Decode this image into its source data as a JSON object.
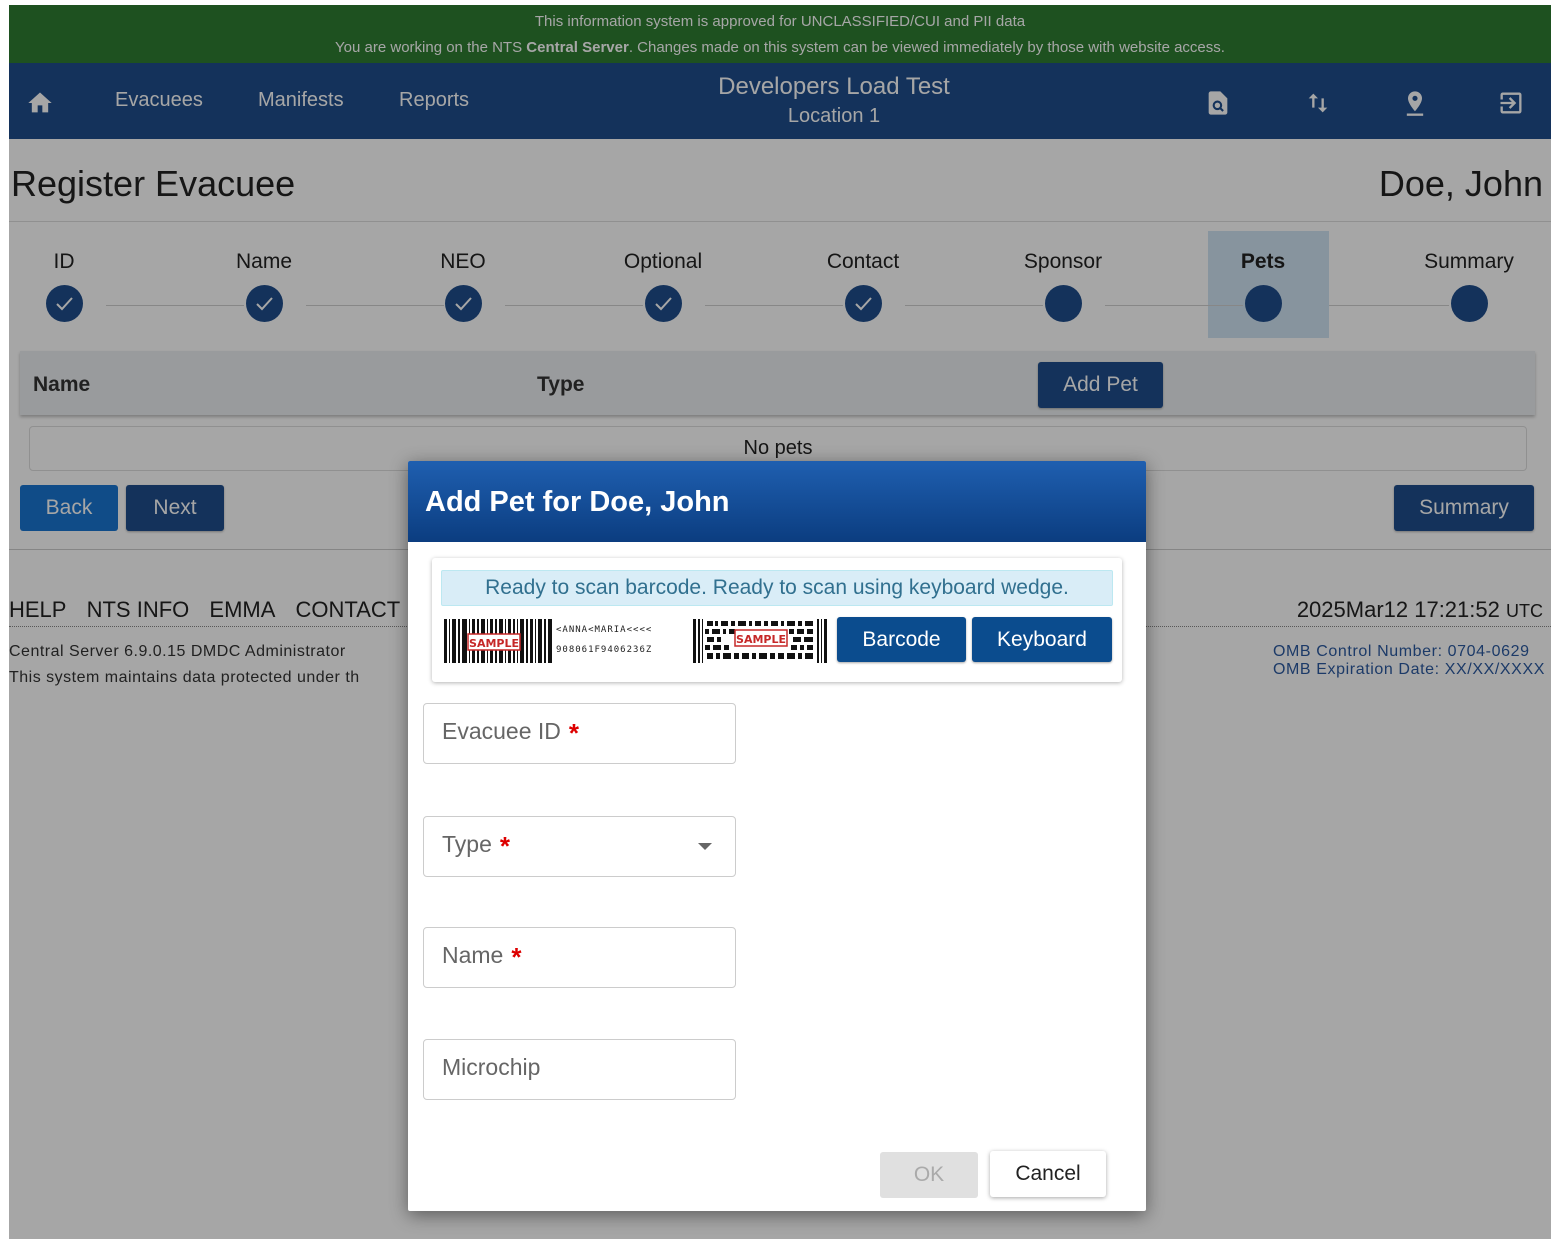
{
  "banner": {
    "line1": "This information system is approved for UNCLASSIFIED/CUI and PII data",
    "line2_pre": "You are working on the NTS ",
    "line2_bold": "Central Server",
    "line2_post": ". Changes made on this system can be viewed immediately by those with website access."
  },
  "nav": {
    "links": [
      "Evacuees",
      "Manifests",
      "Reports"
    ],
    "title": "Developers Load Test",
    "subtitle": "Location 1"
  },
  "page": {
    "title": "Register Evacuee",
    "person": "Doe, John"
  },
  "steps": [
    {
      "label": "ID",
      "done": true
    },
    {
      "label": "Name",
      "done": true
    },
    {
      "label": "NEO",
      "done": true
    },
    {
      "label": "Optional",
      "done": true
    },
    {
      "label": "Contact",
      "done": true
    },
    {
      "label": "Sponsor",
      "done": false
    },
    {
      "label": "Pets",
      "done": false,
      "active": true
    },
    {
      "label": "Summary",
      "done": false
    }
  ],
  "pets_table": {
    "col_name": "Name",
    "col_type": "Type",
    "add_label": "Add Pet",
    "empty": "No pets"
  },
  "nav_buttons": {
    "back": "Back",
    "next": "Next",
    "summary": "Summary"
  },
  "footer": {
    "links": [
      "HELP",
      "NTS INFO",
      "EMMA",
      "CONTACT"
    ],
    "time": "2025Mar12 17:21:52",
    "tz": "UTC",
    "version": "Central Server 6.9.0.15  DMDC Administrator",
    "system_note": "This system maintains data protected under th",
    "omb_number": "OMB Control Number: 0704-0629",
    "omb_expiration": "OMB Expiration Date: XX/XX/XXXX"
  },
  "dialog": {
    "title": "Add Pet for Doe, John",
    "scan_message": "Ready to scan barcode. Ready to scan using keyboard wedge.",
    "sample_label": "SAMPLE",
    "sample_mrz1": "<ANNA<MARIA<<<<",
    "sample_mrz2": "908061F9406236Z",
    "barcode_label": "Barcode",
    "keyboard_label": "Keyboard",
    "fields": {
      "evacuee_id": "Evacuee ID",
      "type": "Type",
      "name": "Name",
      "microchip": "Microchip"
    },
    "required_mark": "*",
    "ok_label": "OK",
    "cancel_label": "Cancel"
  }
}
